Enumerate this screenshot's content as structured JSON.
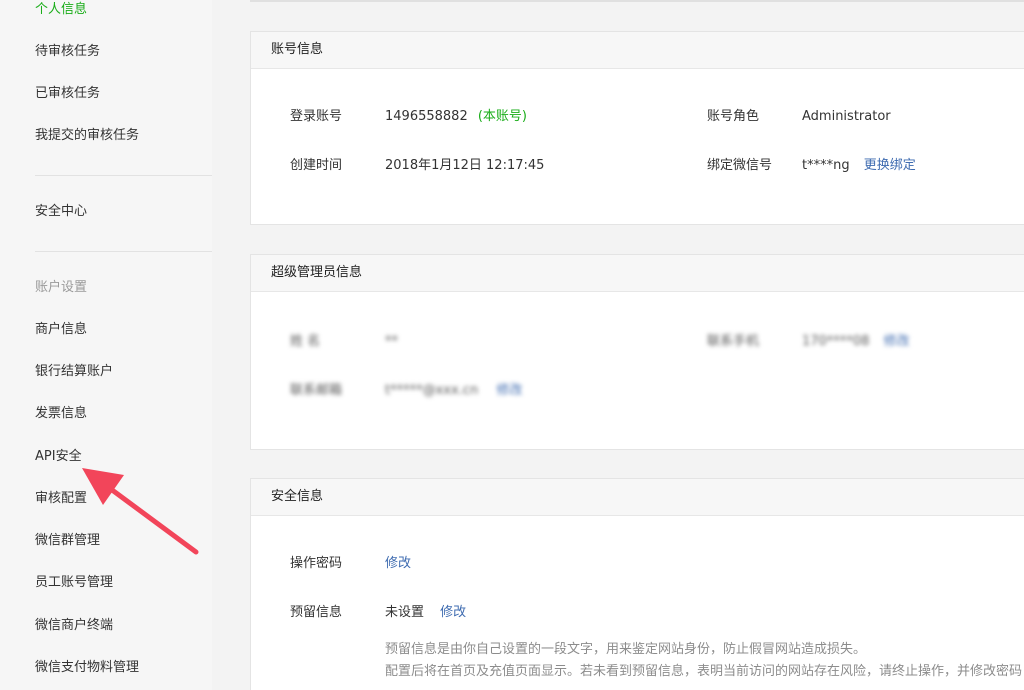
{
  "sidebar": {
    "items_top": [
      "个人信息",
      "待审核任务",
      "已审核任务",
      "我提交的审核任务"
    ],
    "security_center": "安全中心",
    "group_title": "账户设置",
    "items_account": [
      "商户信息",
      "银行结算账户",
      "发票信息",
      "API安全",
      "审核配置",
      "微信群管理",
      "员工账号管理",
      "微信商户终端",
      "微信支付物料管理"
    ]
  },
  "account_info": {
    "title": "账号信息",
    "login_label": "登录账号",
    "login_value": "1496558882",
    "login_tag": "(本账号)",
    "role_label": "账号角色",
    "role_value": "Administrator",
    "created_label": "创建时间",
    "created_value": "2018年1月12日 12:17:45",
    "wechat_label": "绑定微信号",
    "wechat_value": "t****ng",
    "wechat_action": "更换绑定"
  },
  "super_admin": {
    "title": "超级管理员信息",
    "name_label": "姓 名",
    "name_value": "**",
    "phone_label": "联系手机",
    "phone_value": "170****08",
    "phone_action": "修改",
    "email_label": "联系邮箱",
    "email_value": "t*****@xxx.cn",
    "email_action": "修改"
  },
  "security_info": {
    "title": "安全信息",
    "password_label": "操作密码",
    "password_action": "修改",
    "reserved_label": "预留信息",
    "reserved_value": "未设置",
    "reserved_action": "修改",
    "hint_line1": "预留信息是由你自己设置的一段文字，用来鉴定网站身份，防止假冒网站造成损失。",
    "hint_line2": "配置后将在首页及充值页面显示。若未看到预留信息，表明当前访问的网站存在风险，请终止操作，并修改密码"
  },
  "colors": {
    "active": "#1aad19",
    "link": "#3e6bb0",
    "arrow": "#f2455a"
  }
}
